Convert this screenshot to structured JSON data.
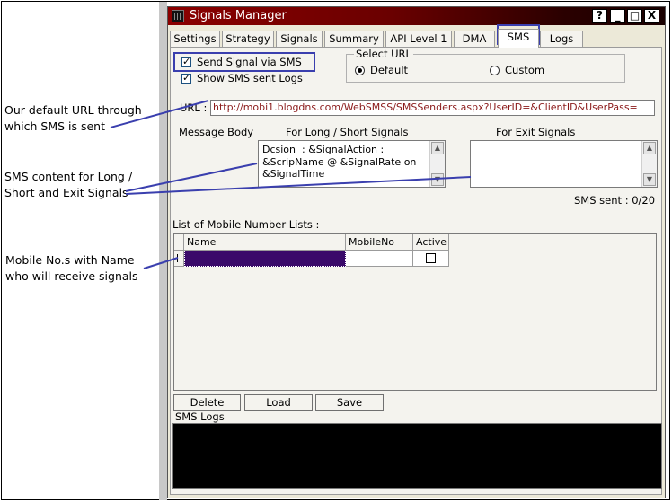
{
  "annotations": {
    "url_note": [
      "Our default URL through",
      "which SMS is sent"
    ],
    "content_note": [
      "SMS content for Long /",
      "Short and Exit Signals"
    ],
    "mobile_note": [
      "Mobile No.s with Name",
      "who will receive signals"
    ]
  },
  "window": {
    "title": "Signals Manager",
    "buttons": {
      "help": "?",
      "minimize": "_",
      "maximize": "□",
      "close": "X"
    }
  },
  "tabs": [
    {
      "label": "Settings",
      "active": false
    },
    {
      "label": "Strategy",
      "active": false
    },
    {
      "label": "Signals",
      "active": false
    },
    {
      "label": "Summary",
      "active": false
    },
    {
      "label": "API Level 1",
      "active": false
    },
    {
      "label": "DMA",
      "active": false
    },
    {
      "label": "SMS",
      "active": true
    },
    {
      "label": "Logs",
      "active": false
    }
  ],
  "sms": {
    "send_signal_label": "Send Signal via SMS",
    "send_signal_checked": true,
    "show_logs_label": "Show SMS sent Logs",
    "show_logs_checked": true,
    "select_url": {
      "legend": "Select URL",
      "default_label": "Default",
      "custom_label": "Custom",
      "selected": "Default"
    },
    "url_label": "URL :",
    "url_value": "http://mobi1.blogdns.com/WebSMSS/SMSSenders.aspx?UserID=&ClientID&UserPass=",
    "message_body_label": "Message Body",
    "long_short_label": "For Long / Short Signals",
    "exit_label": "For Exit Signals",
    "long_short_text": "Dcsion  : &SignalAction :\n&ScripName @ &SignalRate on\n&SignalTime",
    "exit_text": "",
    "sms_sent": "SMS sent : 0/20",
    "list_label": "List of Mobile Number Lists :",
    "grid_columns": [
      "Name",
      "MobileNo",
      "Active"
    ],
    "grid_rows": [
      {
        "name": "",
        "mobile": "",
        "active": false
      }
    ],
    "buttons": {
      "delete": "Delete",
      "load": "Load",
      "save": "Save"
    },
    "logs_label": "SMS Logs"
  },
  "colors": {
    "titlebar_start": "#8b0000",
    "highlight_border": "#3a3fae",
    "url_text": "#8b1a1a",
    "selected_cell": "#3a0a6a",
    "logs_background": "#000000"
  }
}
